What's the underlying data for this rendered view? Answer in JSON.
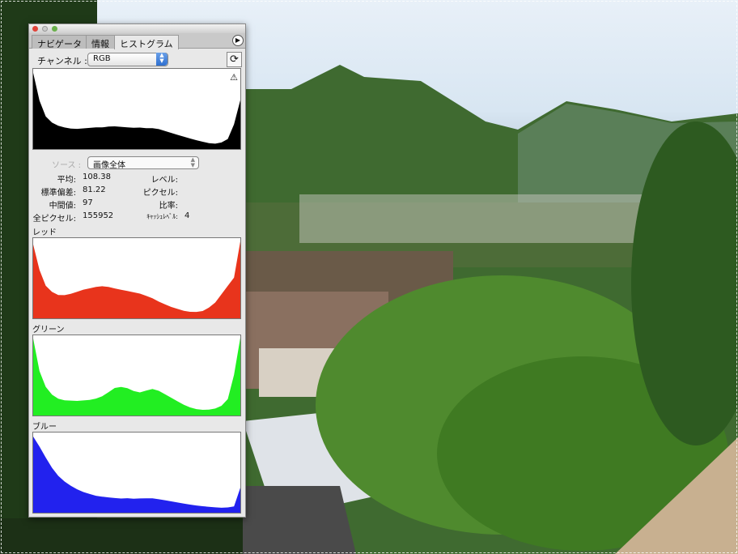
{
  "panel": {
    "tabs": [
      {
        "label": "ナビゲータ"
      },
      {
        "label": "情報"
      },
      {
        "label": "ヒストグラム"
      }
    ],
    "channel_label": "チャンネル :",
    "channel_value": "RGB",
    "source_label": "ソース :",
    "source_value": "画像全体",
    "stats": {
      "mean_label": "平均:",
      "mean": "108.38",
      "std_label": "標準偏差:",
      "std": "81.22",
      "median_label": "中間値:",
      "median": "97",
      "pixels_label": "全ピクセル:",
      "pixels": "155952",
      "level_label": "レベル:",
      "count_label": "ピクセル:",
      "percentile_label": "比率:",
      "cache_label": "ｷｬｯｼｭﾚﾍﾞﾙ:",
      "cache": "4"
    },
    "red_label": "レッド",
    "green_label": "グリーン",
    "blue_label": "ブルー",
    "warning_icon": "cache-warning-icon",
    "refresh_icon": "refresh-icon"
  },
  "histograms": {
    "rgb": {
      "color": "#000000",
      "values": [
        95,
        60,
        40,
        32,
        28,
        26,
        25,
        25,
        26,
        27,
        28,
        28,
        29,
        29,
        28,
        27,
        26,
        26,
        25,
        25,
        24,
        22,
        20,
        18,
        16,
        14,
        12,
        10,
        8,
        7,
        8,
        12,
        30,
        60
      ]
    },
    "red": {
      "color": "#e8341c",
      "values": [
        92,
        60,
        40,
        32,
        28,
        28,
        30,
        33,
        36,
        38,
        40,
        41,
        40,
        38,
        36,
        34,
        32,
        30,
        27,
        24,
        20,
        17,
        14,
        12,
        10,
        9,
        9,
        10,
        14,
        20,
        30,
        40,
        50,
        95
      ]
    },
    "green": {
      "color": "#22ee22",
      "values": [
        96,
        55,
        35,
        25,
        20,
        18,
        18,
        18,
        19,
        20,
        22,
        25,
        30,
        35,
        36,
        34,
        30,
        28,
        30,
        32,
        30,
        26,
        22,
        18,
        14,
        11,
        9,
        8,
        8,
        9,
        12,
        20,
        50,
        96
      ]
    },
    "blue": {
      "color": "#2222ee",
      "values": [
        95,
        82,
        68,
        55,
        45,
        38,
        33,
        29,
        26,
        24,
        22,
        21,
        20,
        19,
        18,
        18,
        17,
        17,
        17,
        17,
        16,
        15,
        14,
        13,
        12,
        11,
        10,
        9,
        8,
        7,
        6,
        6,
        7,
        30
      ]
    }
  }
}
